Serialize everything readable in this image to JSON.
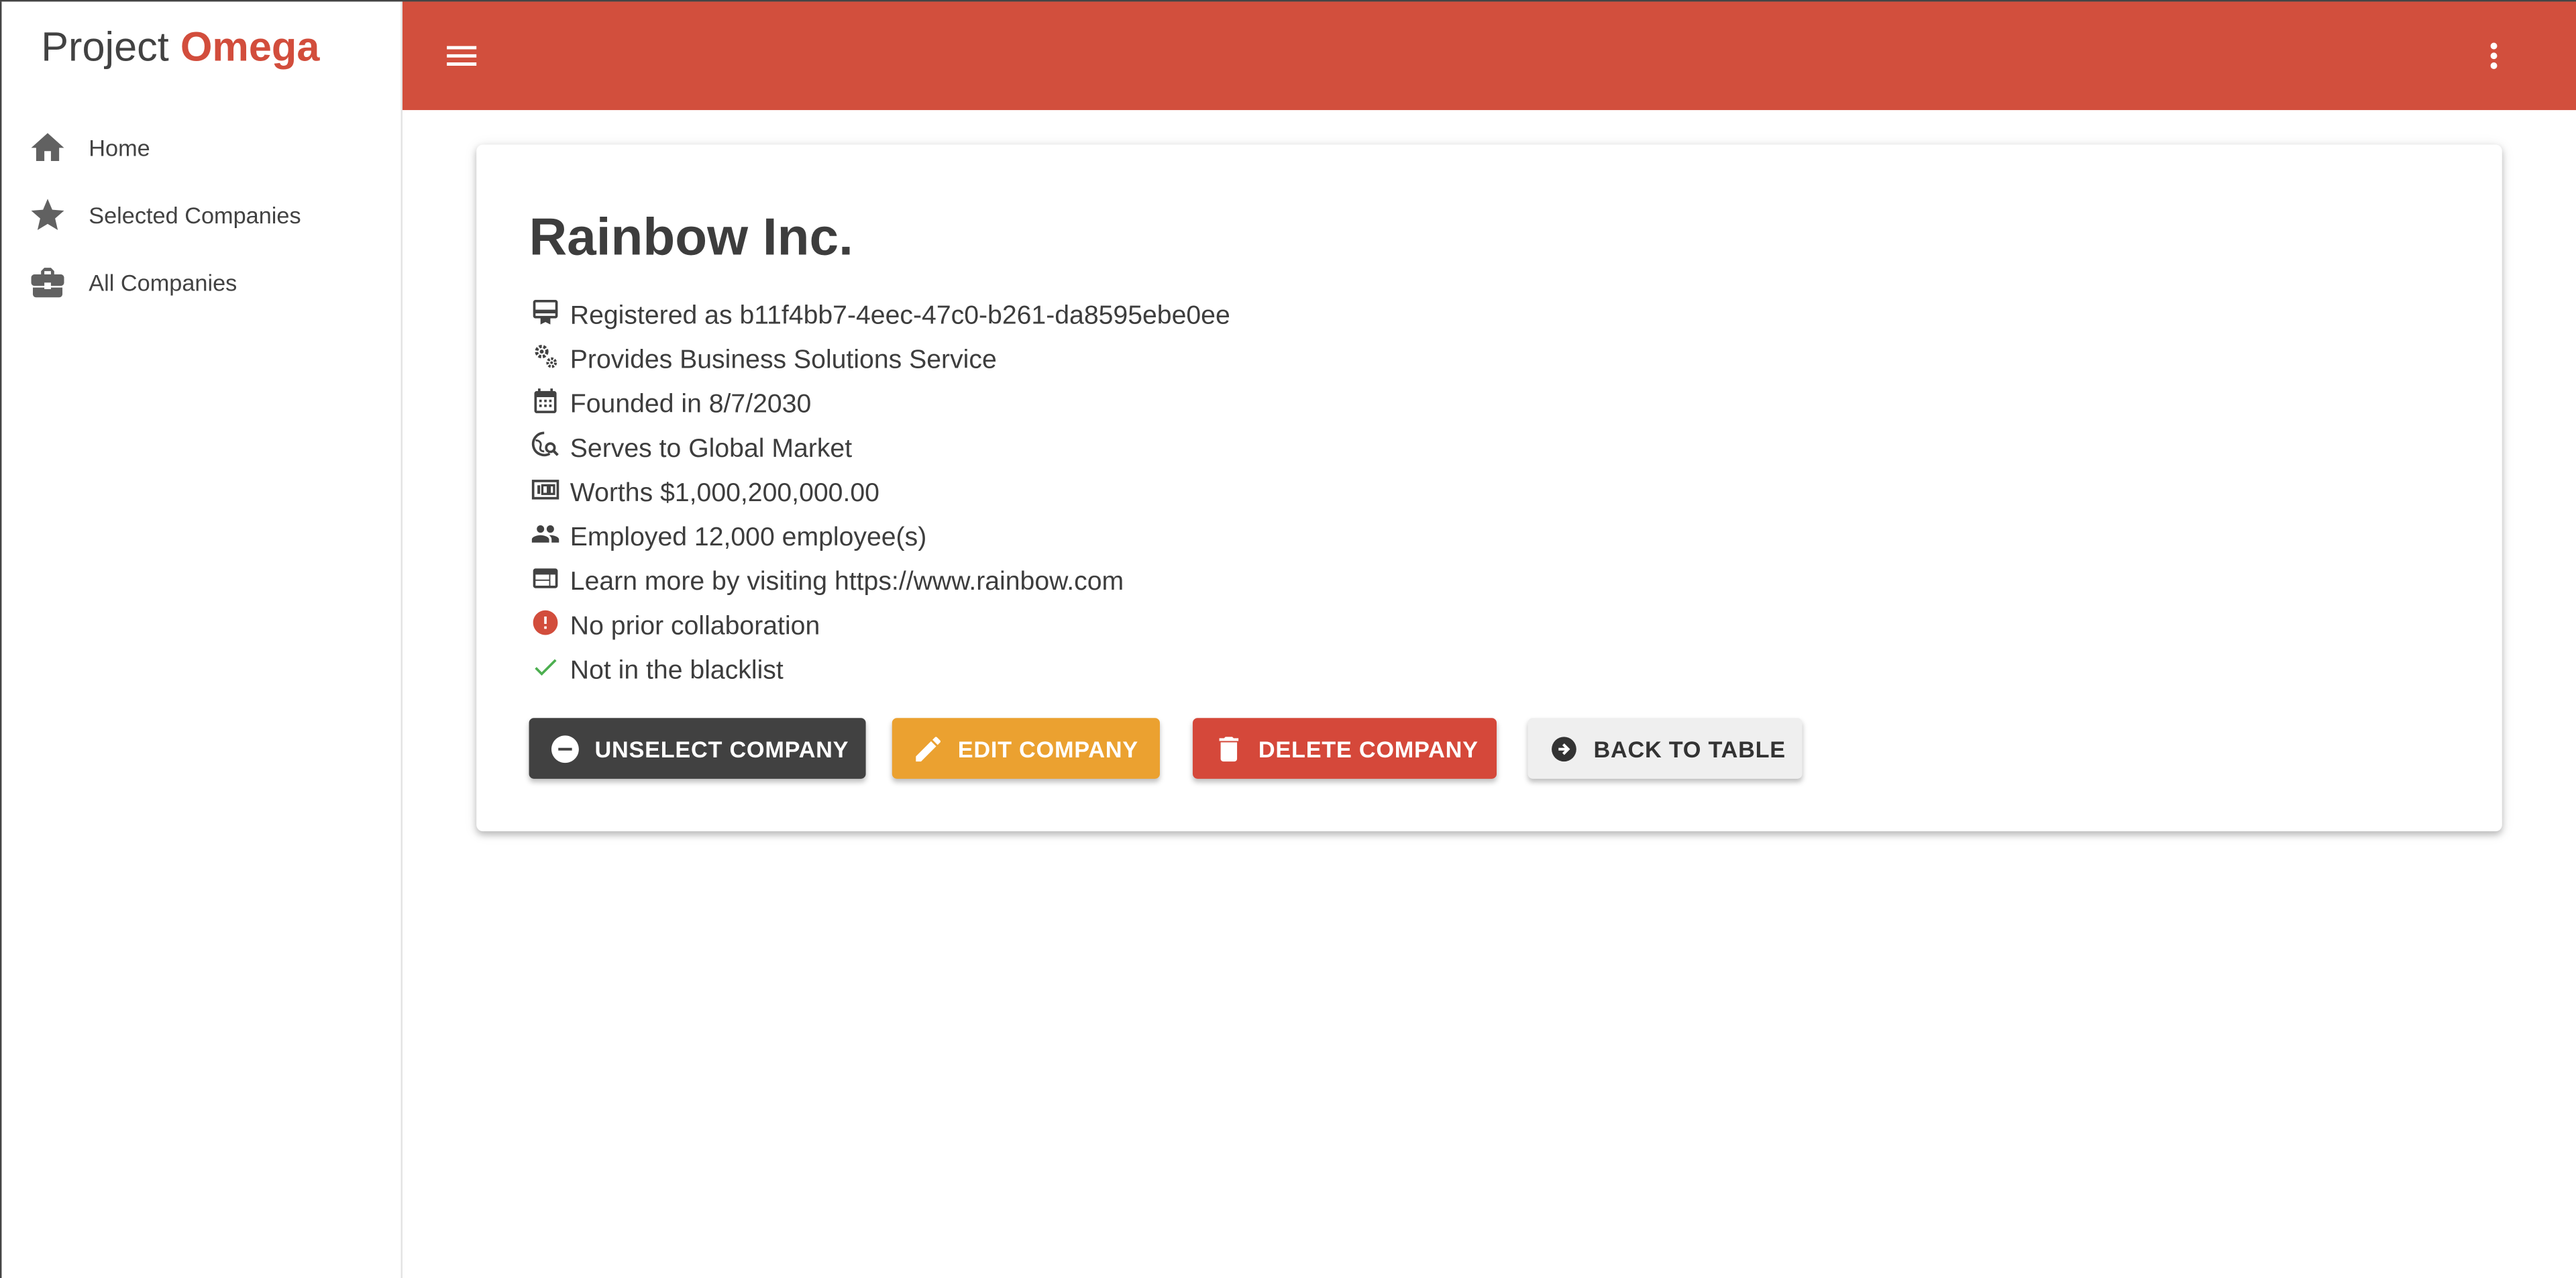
{
  "brand": {
    "name": "Project",
    "accent": "Omega"
  },
  "colors": {
    "primary": "#d24f3d",
    "accent_text": "#d24d3c",
    "button_dark": "#414141",
    "button_warning": "#eba130",
    "button_danger": "#d5483a",
    "button_light": "#efefef",
    "success": "#4caf50",
    "error": "#d24d3c"
  },
  "sidebar": {
    "items": [
      {
        "label": "Home",
        "icon": "home-icon"
      },
      {
        "label": "Selected Companies",
        "icon": "star-icon"
      },
      {
        "label": "All Companies",
        "icon": "briefcase-icon"
      }
    ]
  },
  "topbar": {
    "menu_icon": "menu-icon",
    "more_icon": "more-vert-icon"
  },
  "company": {
    "name": "Rainbow Inc.",
    "details": [
      {
        "icon": "id-card-icon",
        "text": "Registered as b11f4bb7-4eec-47c0-b261-da8595ebe0ee"
      },
      {
        "icon": "gears-icon",
        "text": "Provides Business Solutions Service"
      },
      {
        "icon": "calendar-icon",
        "text": "Founded in 8/7/2030"
      },
      {
        "icon": "travel-explore-icon",
        "text": "Serves to Global Market"
      },
      {
        "icon": "money-icon",
        "text": "Worths $1,000,200,000.00"
      },
      {
        "icon": "people-icon",
        "text": "Employed 12,000 employee(s)"
      },
      {
        "icon": "web-icon",
        "text": "Learn more by visiting https://www.rainbow.com"
      },
      {
        "icon": "error-icon",
        "text": "No prior collaboration"
      },
      {
        "icon": "check-icon",
        "text": "Not in the blacklist"
      }
    ]
  },
  "actions": {
    "unselect": "UNSELECT COMPANY",
    "edit": "EDIT COMPANY",
    "delete": "DELETE COMPANY",
    "back": "BACK TO TABLE"
  }
}
